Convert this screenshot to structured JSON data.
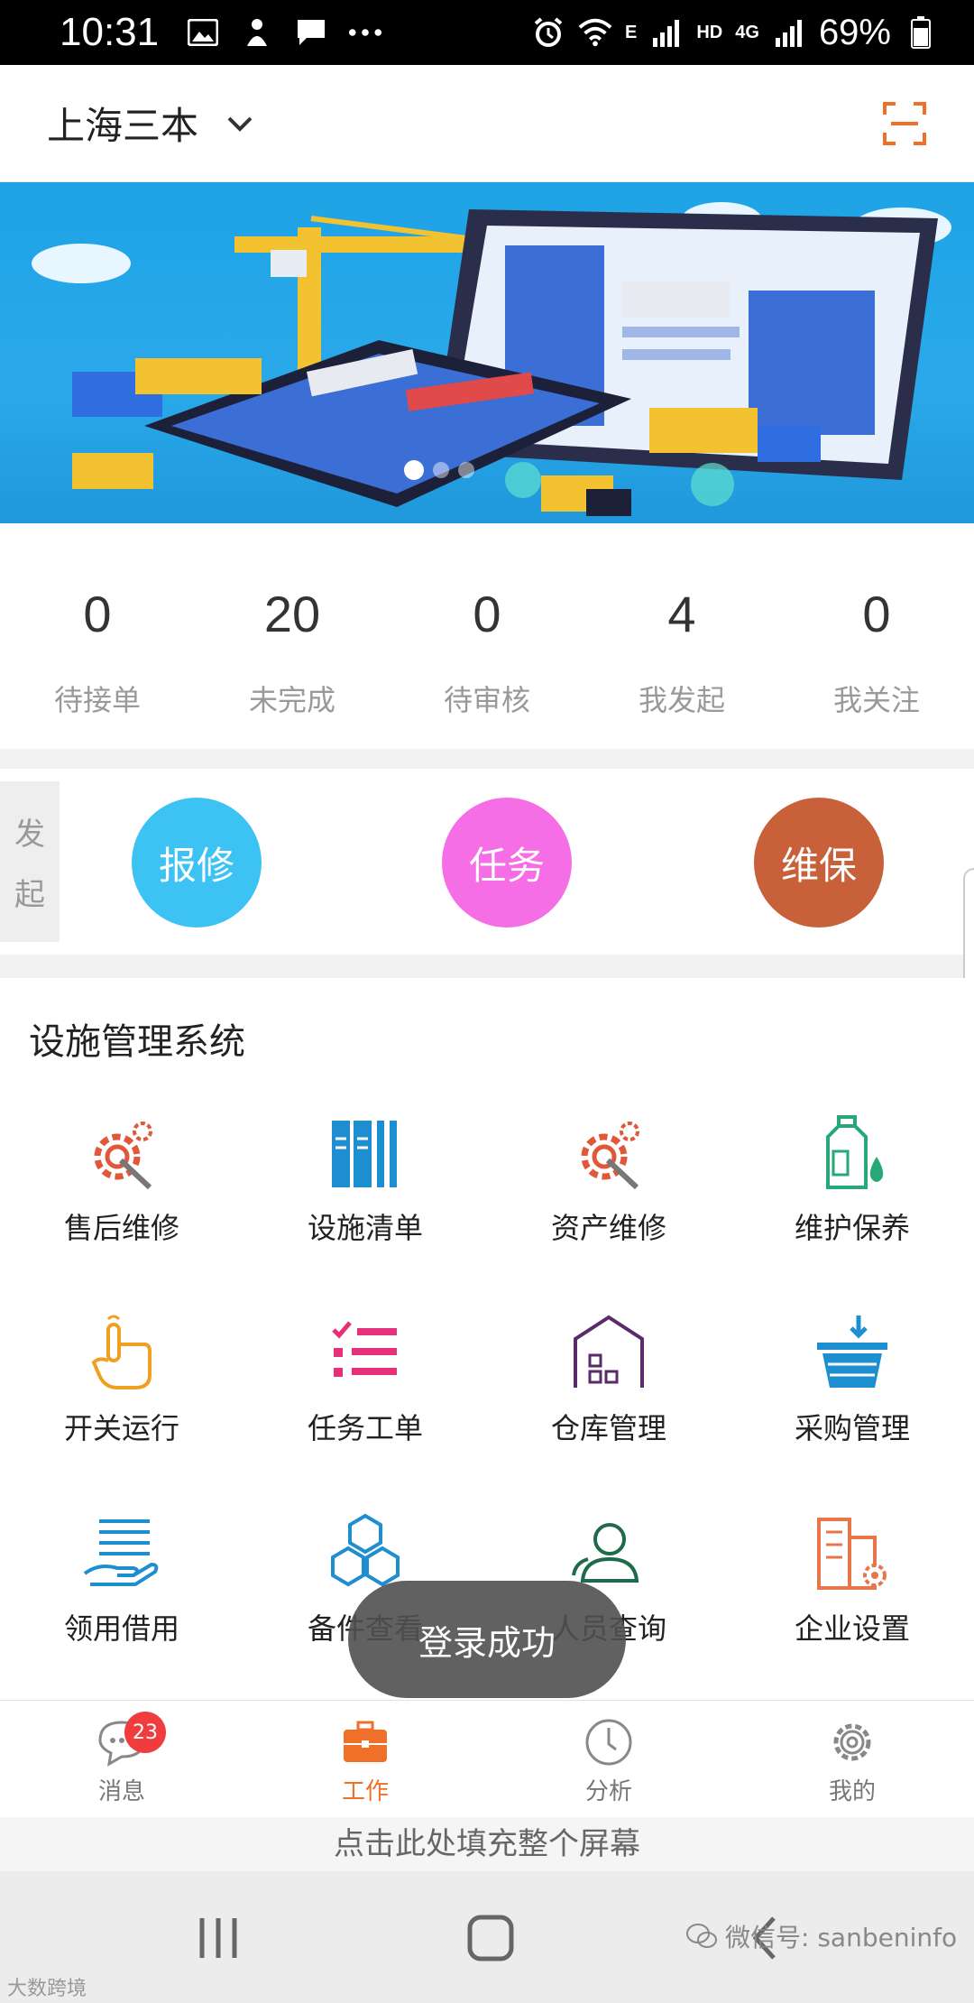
{
  "status_bar": {
    "time": "10:31",
    "battery": "69%",
    "hd_label": "HD",
    "net_label": "4G",
    "e_label": "E"
  },
  "header": {
    "company": "上海三本"
  },
  "stats": [
    {
      "value": "0",
      "label": "待接单"
    },
    {
      "value": "20",
      "label": "未完成"
    },
    {
      "value": "0",
      "label": "待审核"
    },
    {
      "value": "4",
      "label": "我发起"
    },
    {
      "value": "0",
      "label": "我关注"
    }
  ],
  "initiate": {
    "tab_chars": [
      "发",
      "起"
    ],
    "buttons": [
      {
        "label": "报修",
        "color": "#3cc3f3"
      },
      {
        "label": "任务",
        "color": "#f56ee6"
      },
      {
        "label": "维保",
        "color": "#c8603a"
      }
    ]
  },
  "modules": {
    "title": "设施管理系统",
    "items": [
      {
        "label": "售后维修",
        "icon": "gear-wrench-icon"
      },
      {
        "label": "设施清单",
        "icon": "binders-icon"
      },
      {
        "label": "资产维修",
        "icon": "gear-wrench-icon"
      },
      {
        "label": "维护保养",
        "icon": "oil-bottle-icon"
      },
      {
        "label": "开关运行",
        "icon": "hand-pointer-icon"
      },
      {
        "label": "任务工单",
        "icon": "checklist-icon"
      },
      {
        "label": "仓库管理",
        "icon": "warehouse-icon"
      },
      {
        "label": "采购管理",
        "icon": "basket-icon"
      },
      {
        "label": "领用借用",
        "icon": "hand-list-icon"
      },
      {
        "label": "备件查看",
        "icon": "cubes-icon"
      },
      {
        "label": "人员查询",
        "icon": "people-icon"
      },
      {
        "label": "企业设置",
        "icon": "building-gear-icon"
      }
    ]
  },
  "toast": {
    "text": "登录成功"
  },
  "bottom_nav": [
    {
      "label": "消息",
      "icon": "chat-icon",
      "badge": "23"
    },
    {
      "label": "工作",
      "icon": "briefcase-icon",
      "active": true
    },
    {
      "label": "分析",
      "icon": "clock-icon"
    },
    {
      "label": "我的",
      "icon": "settings-icon"
    }
  ],
  "fill_hint": "点击此处填充整个屏幕",
  "watermark": {
    "right": "微信号: sanbeninfo",
    "left": "大数跨境"
  },
  "colors": {
    "accent": "#f0702a",
    "badge": "#f03c3c",
    "banner_blue": "#1ea3e6"
  }
}
